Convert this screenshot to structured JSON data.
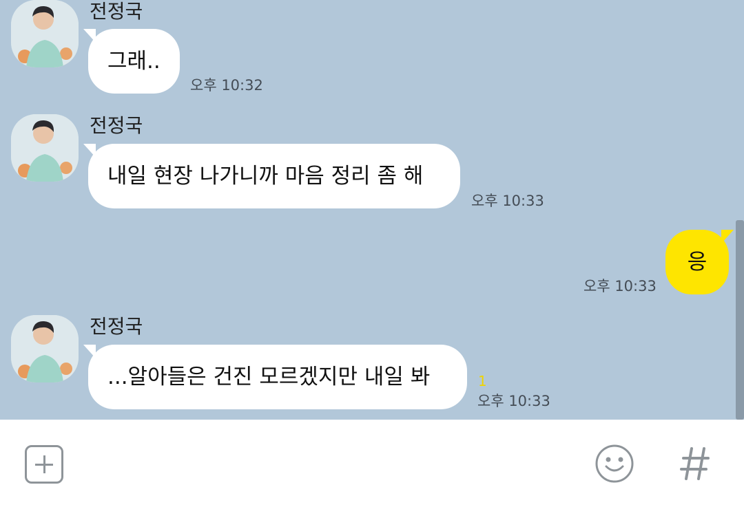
{
  "messages": [
    {
      "sender": "전정국",
      "text": "그래..",
      "time": "오후 10:32"
    },
    {
      "sender": "전정국",
      "text": "내일 현장 나가니까 마음 정리 좀 해",
      "time": "오후 10:33"
    },
    {
      "text": "응",
      "time": "오후 10:33"
    },
    {
      "sender": "전정국",
      "text": "...알아들은 건진 모르겠지만 내일 봐",
      "time": "오후 10:33",
      "unread": "1"
    }
  ],
  "colors": {
    "background": "#b2c7d9",
    "incoming_bubble": "#ffffff",
    "outgoing_bubble": "#fee500",
    "unread_count": "#f0d400"
  },
  "input_bar": {
    "icons": [
      "plus-icon",
      "emoji-icon",
      "hashtag-icon"
    ]
  }
}
